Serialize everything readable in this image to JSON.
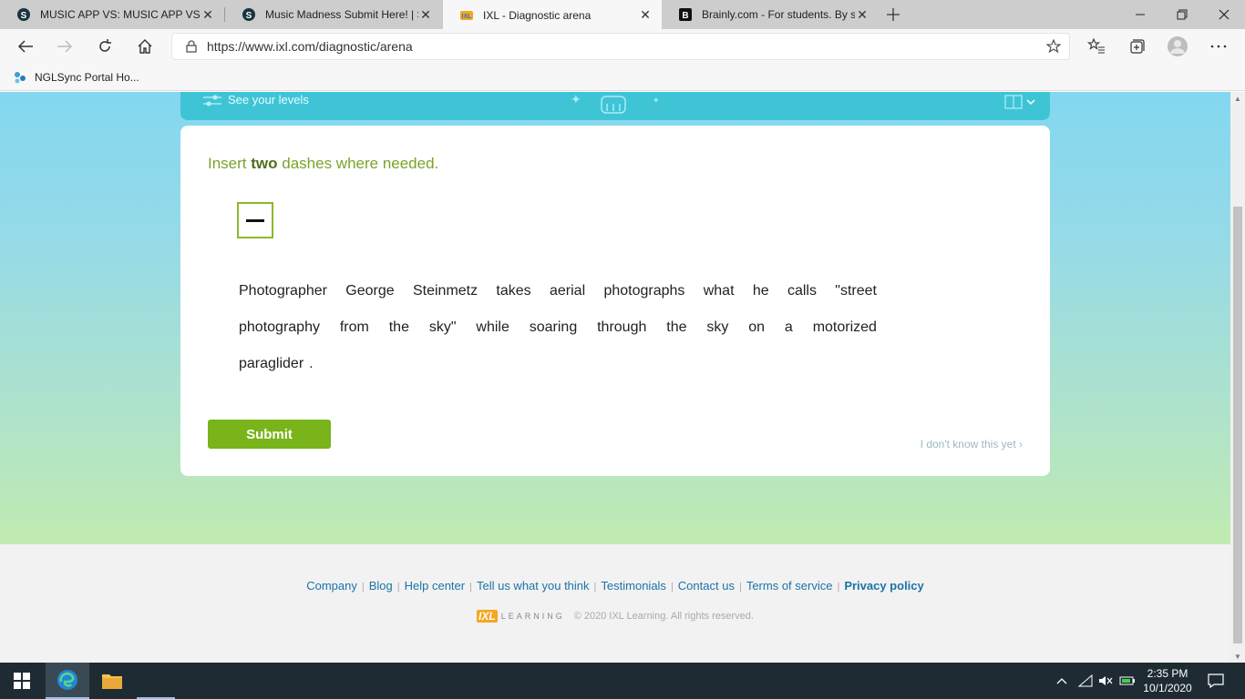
{
  "browser": {
    "tabs": [
      {
        "title": "MUSIC APP VS: MUSIC APP VS-3",
        "icon": "s-circle-icon",
        "active": false
      },
      {
        "title": "Music Madness Submit Here! | S",
        "icon": "s-circle-icon",
        "active": false
      },
      {
        "title": "IXL - Diagnostic arena",
        "icon": "ixl-icon",
        "active": true
      },
      {
        "title": "Brainly.com - For students. By stu",
        "icon": "brainly-icon",
        "active": false
      }
    ],
    "url": "https://www.ixl.com/diagnostic/arena",
    "bookmarks": [
      {
        "label": "NGLSync Portal Ho..."
      }
    ]
  },
  "page": {
    "levels_label": "See your levels",
    "question": {
      "prompt_before": "Insert ",
      "prompt_emphasis": "two",
      "prompt_after": " dashes where needed.",
      "tile_symbol": "—",
      "sentence_lines": [
        [
          "Photographer",
          "George",
          "Steinmetz",
          "takes",
          "aerial",
          "photographs",
          "what",
          "he",
          "calls",
          "\"street"
        ],
        [
          "photography",
          "from",
          "the",
          "sky\"",
          "while",
          "soaring",
          "through",
          "the",
          "sky",
          "on",
          "a",
          "motorized"
        ],
        [
          "paraglider",
          "."
        ]
      ]
    },
    "submit_label": "Submit",
    "dont_know_label": "I don't know this yet ›"
  },
  "footer": {
    "links": [
      "Company",
      "Blog",
      "Help center",
      "Tell us what you think",
      "Testimonials",
      "Contact us",
      "Terms of service",
      "Privacy policy"
    ],
    "logo_word": "LEARNING",
    "copyright": "© 2020 IXL Learning. All rights reserved."
  },
  "taskbar": {
    "time": "2:35 PM",
    "date": "10/1/2020"
  },
  "colors": {
    "accent_green": "#78b41a",
    "prompt_green": "#7aa32a",
    "link_blue": "#1a74a8",
    "levels_bar": "#3fc4d6"
  }
}
